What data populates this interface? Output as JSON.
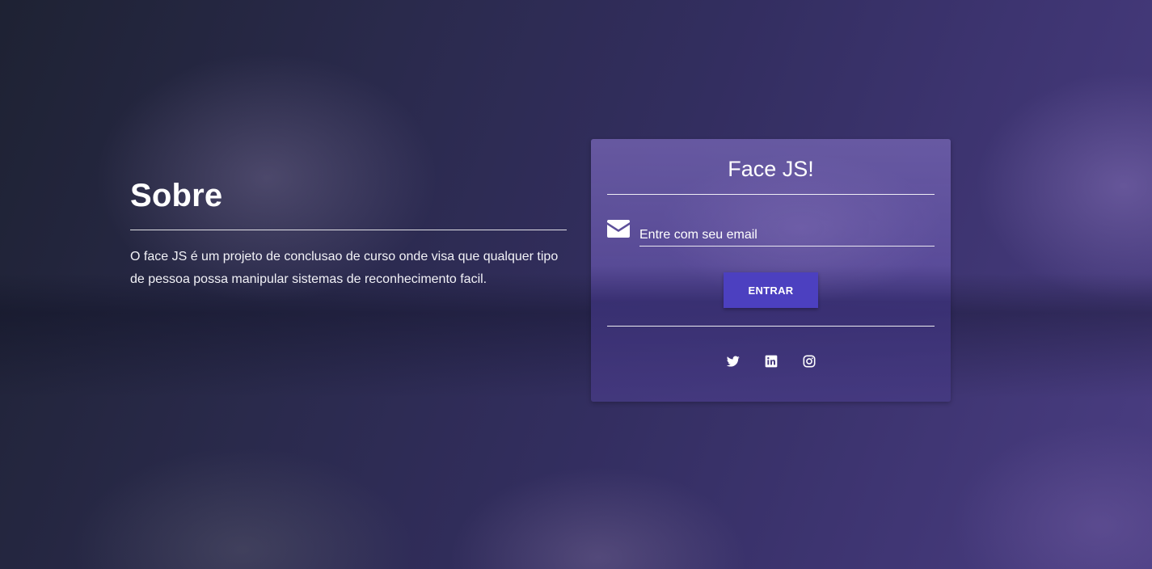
{
  "about": {
    "title": "Sobre",
    "description": "O face JS é um projeto de conclusao de curso onde visa que qualquer tipo de pessoa possa manipular sistemas de reconhecimento facil."
  },
  "login_card": {
    "title": "Face JS!",
    "email_icon": "envelope-icon",
    "email_placeholder": "Entre com seu email",
    "email_value": "",
    "submit_label": "ENTRAR",
    "social": [
      {
        "icon": "twitter-icon"
      },
      {
        "icon": "linkedin-icon"
      },
      {
        "icon": "instagram-icon"
      }
    ]
  },
  "colors": {
    "button": "#4c40c0",
    "card": "#5f50a0",
    "text": "#ffffff"
  }
}
